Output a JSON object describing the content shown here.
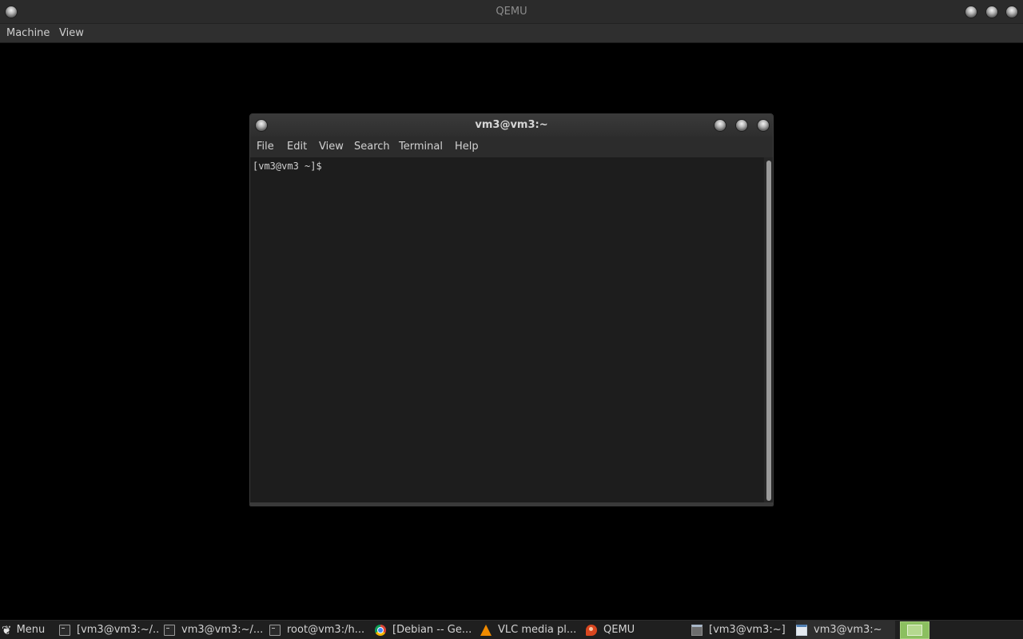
{
  "qemu": {
    "title": "QEMU",
    "menu": [
      "Machine",
      "View"
    ]
  },
  "terminal": {
    "title": "vm3@vm3:~",
    "menu": [
      "File",
      "Edit",
      "View",
      "Search",
      "Terminal",
      "Help"
    ],
    "prompt": "[vm3@vm3 ~]$"
  },
  "taskbar": {
    "menu_label": "Menu",
    "menu_icon": "mint-leaf-icon",
    "tasks": [
      {
        "label": "[vm3@vm3:~/...",
        "icon": "terminal-icon"
      },
      {
        "label": "vm3@vm3:~/...",
        "icon": "terminal-icon"
      },
      {
        "label": "root@vm3:/h...",
        "icon": "terminal-icon"
      },
      {
        "label": "[Debian -- Ge...",
        "icon": "chrome-icon"
      },
      {
        "label": "VLC media pl...",
        "icon": "vlc-cone-icon"
      },
      {
        "label": "QEMU",
        "icon": "qemu-icon"
      },
      {
        "label": "[vm3@vm3:~]",
        "icon": "window-icon"
      },
      {
        "label": "vm3@vm3:~",
        "icon": "window-icon"
      }
    ],
    "workspace_color": "#8bbf5f"
  }
}
